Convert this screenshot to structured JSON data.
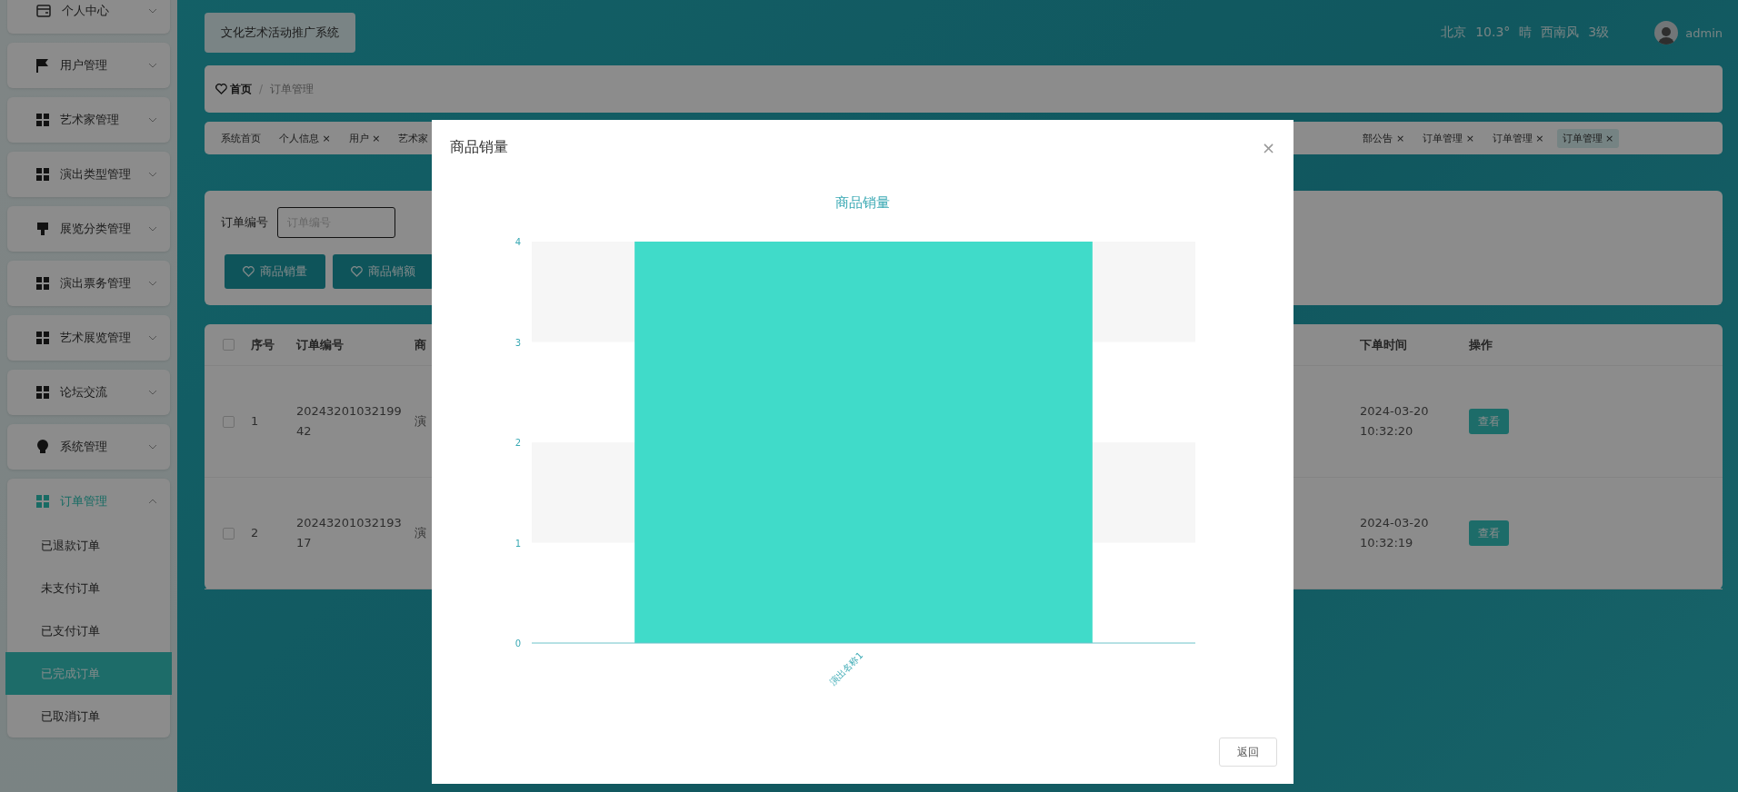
{
  "sidebar": {
    "items": [
      {
        "label": "个人中心",
        "expanded": false
      },
      {
        "label": "用户管理",
        "expanded": false
      },
      {
        "label": "艺术家管理",
        "expanded": false
      },
      {
        "label": "演出类型管理",
        "expanded": false
      },
      {
        "label": "展览分类管理",
        "expanded": false
      },
      {
        "label": "演出票务管理",
        "expanded": false
      },
      {
        "label": "艺术展览管理",
        "expanded": false
      },
      {
        "label": "论坛交流",
        "expanded": false
      },
      {
        "label": "系统管理",
        "expanded": false
      },
      {
        "label": "订单管理",
        "expanded": true,
        "children": [
          {
            "label": "已退款订单",
            "selected": false
          },
          {
            "label": "未支付订单",
            "selected": false
          },
          {
            "label": "已支付订单",
            "selected": false
          },
          {
            "label": "已完成订单",
            "selected": true
          },
          {
            "label": "已取消订单",
            "selected": false
          }
        ]
      }
    ]
  },
  "header": {
    "title": "文化艺术活动推广系统",
    "weather": [
      "北京",
      "10.3°",
      "晴",
      "西南风",
      "3级"
    ],
    "user": "admin"
  },
  "breadcrumb": {
    "separator": "/",
    "items": [
      {
        "label": "首页"
      },
      {
        "label": "订单管理"
      }
    ]
  },
  "tabs": {
    "left": [
      {
        "label": "系统首页",
        "selected": false
      },
      {
        "label": "个人信息",
        "close": "×",
        "selected": false
      },
      {
        "label": "用户",
        "close": "×",
        "selected": false
      },
      {
        "label": "艺术家",
        "selected": false
      }
    ],
    "right": [
      {
        "label": "部公告",
        "close": "×",
        "selected": false
      },
      {
        "label": "订单管理",
        "close": "×",
        "selected": false
      },
      {
        "label": "订单管理",
        "close": "×",
        "selected": false
      },
      {
        "label": "订单管理",
        "close": "×",
        "selected": true
      }
    ]
  },
  "search": {
    "label": "订单编号",
    "placeholder": "订单编号",
    "buttons": [
      "商品销量",
      "商品销额"
    ]
  },
  "table": {
    "select_all": false,
    "columns": [
      "序号",
      "订单编号",
      "商",
      "下单时间",
      "操作"
    ],
    "rows": [
      {
        "checked": false,
        "index": "1",
        "order_no": "2024320103219942",
        "column_3": "演",
        "time": "2024-03-20 10:32:20",
        "action": "查看"
      },
      {
        "checked": false,
        "index": "2",
        "order_no": "2024320103219317",
        "column_3": "演",
        "time": "2024-03-20 10:32:19",
        "action": "查看"
      }
    ]
  },
  "modal": {
    "title": "商品销量",
    "close": "×",
    "button": "返回",
    "chart_data": {
      "type": "bar",
      "title": "商品销量",
      "categories": [
        "演出名称1"
      ],
      "values": [
        4
      ],
      "ylim": [
        0,
        4
      ],
      "yticks": [
        0,
        1,
        2,
        3,
        4
      ]
    }
  }
}
